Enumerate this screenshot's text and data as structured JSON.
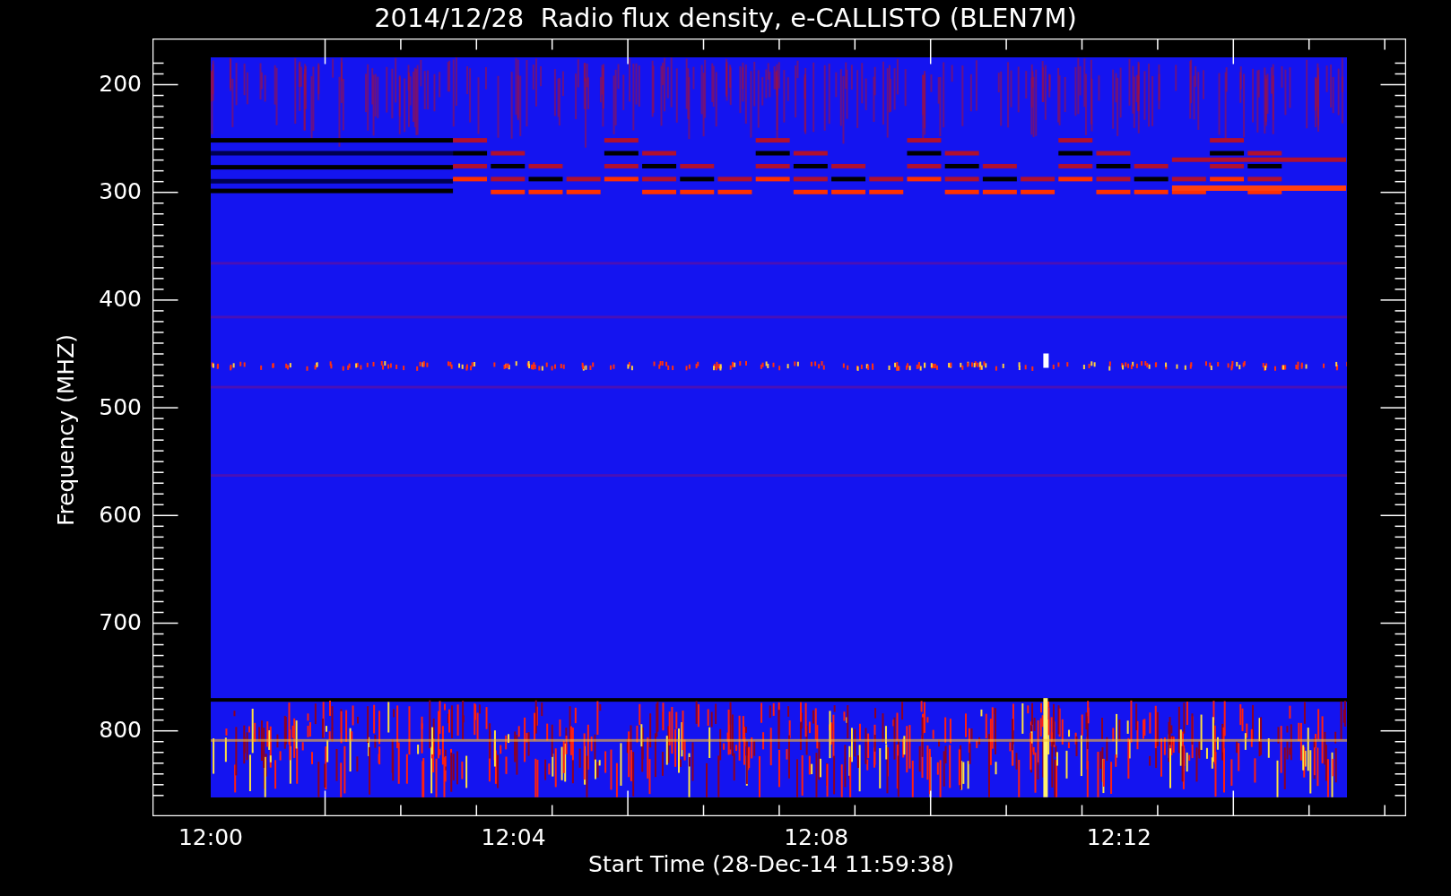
{
  "title": "2014/12/28  Radio flux density, e-CALLISTO (BLEN7M)",
  "y_axis": {
    "label": "Frequency (MHZ)",
    "ticks": [
      "200",
      "300",
      "400",
      "500",
      "600",
      "700",
      "800"
    ]
  },
  "x_axis": {
    "label": "Start Time (28-Dec-14 11:59:38)",
    "ticks": [
      "12:00",
      "12:04",
      "12:08",
      "12:12"
    ]
  }
}
